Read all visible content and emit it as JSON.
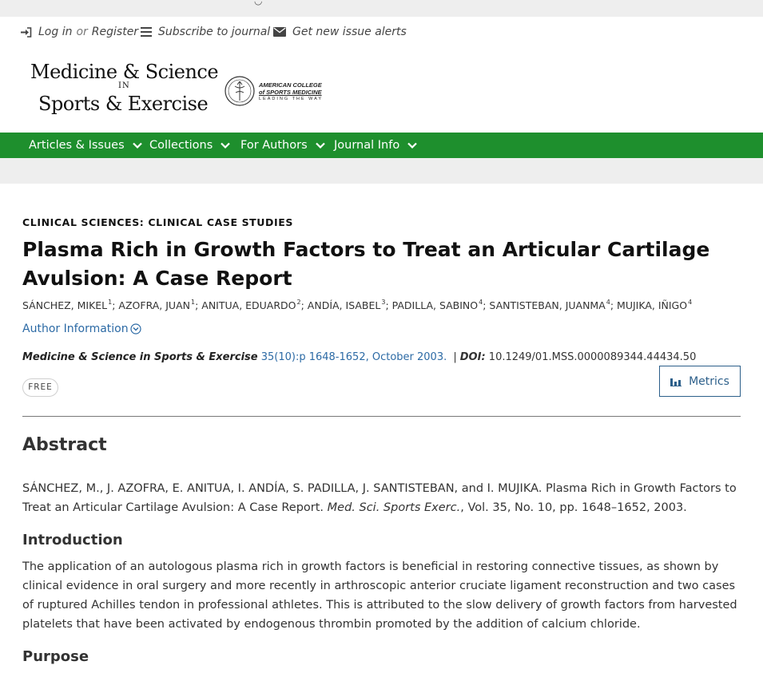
{
  "utility": {
    "login": "Log in",
    "or": "or",
    "register": "Register",
    "subscribe": "Subscribe to journal",
    "alerts": "Get new issue alerts"
  },
  "logo": {
    "line1": "Medicine & Science",
    "in": "IN",
    "line2": "Sports & Exercise",
    "acsm_line1": "AMERICAN COLLEGE",
    "acsm_line2": "of SPORTS MEDICINE",
    "acsm_line3": "LEADING THE WAY"
  },
  "nav": {
    "items": [
      {
        "label": "Articles & Issues"
      },
      {
        "label": "Collections"
      },
      {
        "label": "For Authors"
      },
      {
        "label": "Journal Info"
      }
    ]
  },
  "article": {
    "section": "CLINICAL SCIENCES: CLINICAL CASE STUDIES",
    "title": "Plasma Rich in Growth Factors to Treat an Articular Cartilage Avulsion: A Case Report",
    "authors": [
      {
        "name": "SÁNCHEZ, MIKEL",
        "sup": "1"
      },
      {
        "name": "AZOFRA, JUAN",
        "sup": "1"
      },
      {
        "name": "ANITUA, EDUARDO",
        "sup": "2"
      },
      {
        "name": "ANDÍA, ISABEL",
        "sup": "3"
      },
      {
        "name": "PADILLA, SABINO",
        "sup": "4"
      },
      {
        "name": "SANTISTEBAN, JUANMA",
        "sup": "4"
      },
      {
        "name": "MUJIKA, IÑIGO",
        "sup": "4"
      }
    ],
    "author_info": "Author Information",
    "journal": "Medicine & Science in Sports & Exercise",
    "volume": "35(10):p 1648-1652, October 2003.",
    "separator": "|",
    "doi_label": "DOI:",
    "doi": "10.1249/01.MSS.0000089344.44434.50",
    "free": "FREE",
    "metrics": "Metrics"
  },
  "abstract": {
    "heading": "Abstract",
    "cite_text": "SÁNCHEZ, M., J. AZOFRA, E. ANITUA, I. ANDÍA, S. PADILLA, J. SANTISTEBAN, and I. MUJIKA. Plasma Rich in Growth Factors to Treat an Articular Cartilage Avulsion: A Case Report.",
    "cite_journal": "Med. Sci. Sports Exerc.",
    "cite_rest": ", Vol. 35, No. 10, pp. 1648–1652, 2003.",
    "intro_heading": "Introduction",
    "intro_text": "The application of an autologous plasma rich in growth factors is beneficial in restoring connective tissues, as shown by clinical evidence in oral surgery and more recently in arthroscopic anterior cruciate ligament reconstruction and two cases of ruptured Achilles tendon in professional athletes. This is attributed to the slow delivery of growth factors from harvested platelets that have been activated by endogenous thrombin promoted by the addition of calcium chloride.",
    "purpose_heading": "Purpose"
  },
  "colors": {
    "nav_green": "#1e8f2d",
    "link_blue": "#2c6aa5",
    "metrics_blue": "#2c5f8a"
  }
}
